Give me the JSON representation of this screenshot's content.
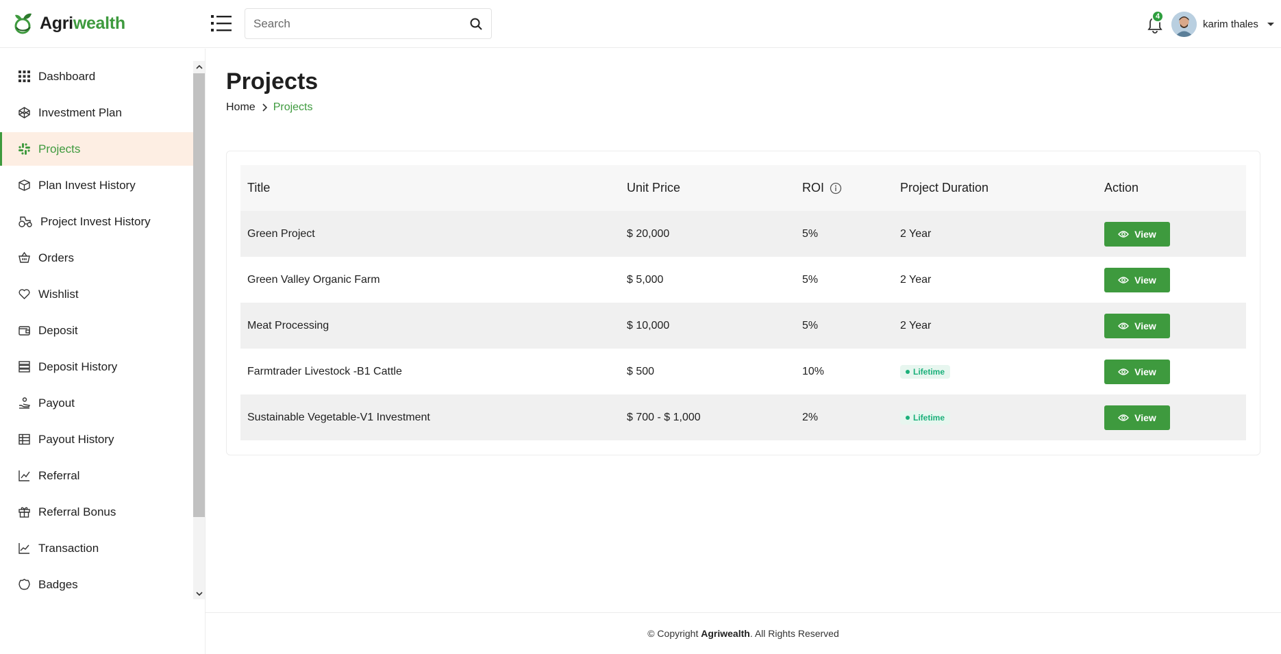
{
  "brand": {
    "name_part1": "Agri",
    "name_part2": "wealth",
    "accent": "#3e9a3e"
  },
  "header": {
    "search_placeholder": "Search",
    "notifications_count": "4",
    "user_name": "karim thales"
  },
  "sidebar": {
    "items": [
      {
        "label": "Dashboard",
        "icon": "grid-icon"
      },
      {
        "label": "Investment Plan",
        "icon": "codepen-icon"
      },
      {
        "label": "Projects",
        "icon": "slack-icon",
        "active": true
      },
      {
        "label": "Plan Invest History",
        "icon": "box-icon"
      },
      {
        "label": "Project Invest History",
        "icon": "tractor-icon"
      },
      {
        "label": "Orders",
        "icon": "basket-icon"
      },
      {
        "label": "Wishlist",
        "icon": "heart-icon"
      },
      {
        "label": "Deposit",
        "icon": "wallet-icon"
      },
      {
        "label": "Deposit History",
        "icon": "server-icon"
      },
      {
        "label": "Payout",
        "icon": "hand-coin-icon"
      },
      {
        "label": "Payout History",
        "icon": "table-icon"
      },
      {
        "label": "Referral",
        "icon": "chart-line-icon"
      },
      {
        "label": "Referral Bonus",
        "icon": "gift-icon"
      },
      {
        "label": "Transaction",
        "icon": "trend-icon"
      },
      {
        "label": "Badges",
        "icon": "badge-icon"
      }
    ]
  },
  "page": {
    "title": "Projects",
    "breadcrumb": {
      "home": "Home",
      "current": "Projects"
    }
  },
  "table": {
    "headers": {
      "title": "Title",
      "unit_price": "Unit Price",
      "roi": "ROI",
      "duration": "Project Duration",
      "action": "Action"
    },
    "rows": [
      {
        "title": "Green Project",
        "unit_price": "$ 20,000",
        "roi": "5%",
        "duration": "2 Year",
        "lifetime": false,
        "action": "View"
      },
      {
        "title": "Green Valley Organic Farm",
        "unit_price": "$ 5,000",
        "roi": "5%",
        "duration": "2 Year",
        "lifetime": false,
        "action": "View"
      },
      {
        "title": "Meat Processing",
        "unit_price": "$ 10,000",
        "roi": "5%",
        "duration": "2 Year",
        "lifetime": false,
        "action": "View"
      },
      {
        "title": "Farmtrader Livestock -B1 Cattle",
        "unit_price": "$ 500",
        "roi": "10%",
        "duration": "Lifetime",
        "lifetime": true,
        "action": "View"
      },
      {
        "title": "Sustainable Vegetable-V1 Investment",
        "unit_price": "$ 700 - $ 1,000",
        "roi": "2%",
        "duration": "Lifetime",
        "lifetime": true,
        "action": "View"
      }
    ]
  },
  "footer": {
    "prefix": "© Copyright",
    "brand": "Agriwealth",
    "suffix": ". All Rights Reserved"
  }
}
